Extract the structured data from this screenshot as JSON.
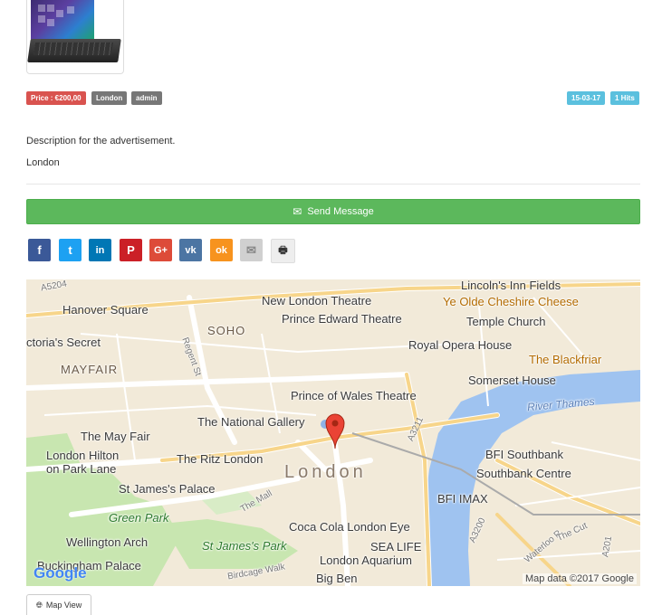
{
  "labels": {
    "price": "Price : €200,00",
    "city": "London",
    "user": "admin",
    "date": "15-03-17",
    "hits": "1 Hits"
  },
  "description": "Description for the advertisement.",
  "location_text": "London",
  "send_button": {
    "label": "Send Message",
    "icon": "envelope-icon"
  },
  "share_buttons": [
    {
      "name": "facebook",
      "glyph": "f",
      "color": "#3b5998"
    },
    {
      "name": "twitter",
      "glyph": "t",
      "color": "#1da1f2"
    },
    {
      "name": "linkedin",
      "glyph": "in",
      "color": "#0077b5"
    },
    {
      "name": "pinterest",
      "glyph": "P",
      "color": "#cb2027"
    },
    {
      "name": "google-plus",
      "glyph": "G+",
      "color": "#dd4b39"
    },
    {
      "name": "vk",
      "glyph": "vk",
      "color": "#4c75a3"
    },
    {
      "name": "odnoklassniki",
      "glyph": "ok",
      "color": "#f7931e"
    },
    {
      "name": "email",
      "glyph": "✉",
      "color": "#d0d0d0"
    },
    {
      "name": "print",
      "glyph": "🖶",
      "color": "#eeeeee"
    }
  ],
  "map": {
    "labels": {
      "lincolns_inn": "Lincoln's Inn Fields",
      "ye_olde": "Ye Olde Cheshire Cheese",
      "new_london_theatre": "New London Theatre",
      "hanover_square": "Hanover Square",
      "prince_edward": "Prince Edward Theatre",
      "temple_church": "Temple Church",
      "soho": "SOHO",
      "victorias_secret": "ctoria's Secret",
      "royal_opera": "Royal Opera House",
      "mayfair": "MAYFAIR",
      "blackfriar": "The Blackfriar",
      "somerset": "Somerset House",
      "prince_of_wales": "Prince of Wales Theatre",
      "river_thames": "River Thames",
      "national_gallery": "The National Gallery",
      "may_fair": "The May Fair",
      "london_hilton": "London Hilton",
      "park_lane": "on Park Lane",
      "ritz": "The Ritz London",
      "bfi_southbank": "BFI Southbank",
      "london": "London",
      "southbank_centre": "Southbank Centre",
      "st_james_palace": "St James's Palace",
      "bfi_imax": "BFI IMAX",
      "green_park": "Green Park",
      "coca_cola": "Coca Cola London Eye",
      "wellington": "Wellington Arch",
      "st_james_park": "St James's Park",
      "sea_life": "SEA LIFE",
      "buckingham": "Buckingham Palace",
      "aquarium": "London Aquarium",
      "big_ben": "Big Ben",
      "regent_st": "Regent St",
      "the_mall": "The Mall",
      "birdcage": "Birdcage Walk",
      "a5204": "A5204",
      "a3211": "A3211",
      "a3200": "A3200",
      "waterloo": "Waterloo R",
      "the_cut": "The Cut",
      "a201": "A201"
    },
    "logo": "Google",
    "credit": "Map data ©2017 Google"
  },
  "map_view_tab": "Map View"
}
